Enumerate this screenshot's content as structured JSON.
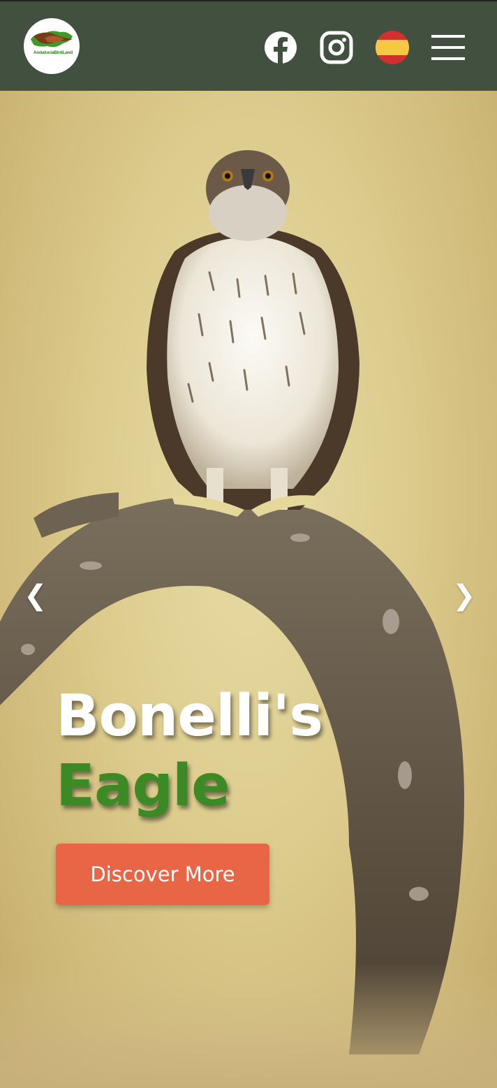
{
  "header": {
    "logo_text": "AndalucíaBirdLand",
    "icons": [
      "facebook-icon",
      "instagram-icon",
      "spanish-flag-icon",
      "hamburger-menu-icon"
    ]
  },
  "hero": {
    "title_line1": "Bonelli's",
    "title_line2": "Eagle",
    "cta_label": "Discover More",
    "prev_arrow": "❮",
    "next_arrow": "❯"
  },
  "colors": {
    "header_bg": "#41503f",
    "accent_green": "#3b8a26",
    "cta_bg": "#e86545",
    "flag_red": "#d32f2f",
    "flag_yellow": "#f6c945"
  }
}
